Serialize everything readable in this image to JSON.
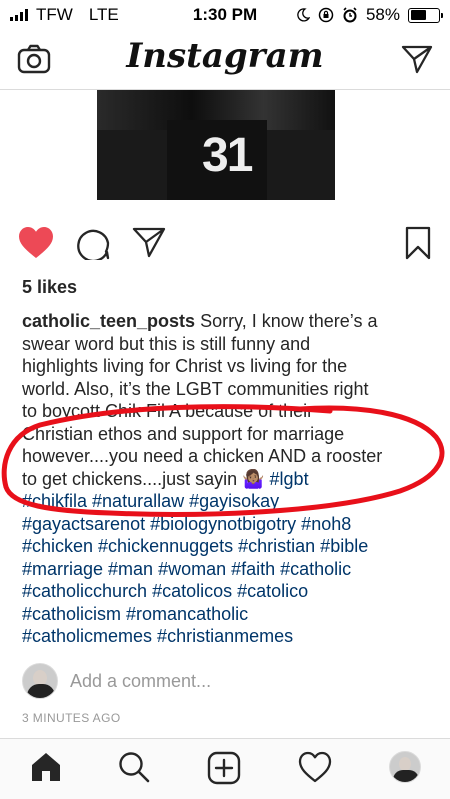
{
  "status_bar": {
    "carrier": "TFW",
    "network": "LTE",
    "time": "1:30 PM",
    "battery": "58%",
    "battery_level": 0.58
  },
  "header": {
    "logo": "Instagram"
  },
  "post": {
    "photo_text": "31",
    "liked": true,
    "likes": "5 likes",
    "username": "catholic_teen_posts",
    "caption_lines": [
      " Sorry, I know there’s a",
      "swear word but this is still funny and",
      "highlights living for Christ vs living for the",
      "world. Also, it’s the LGBT communities right",
      "to boycott Chik Fil A because of their",
      "Christian ethos and support for marriage",
      "however....you need a chicken AND a rooster",
      "to get chickens....just sayin 🤷🏽‍♀️ "
    ],
    "hashtags_first": "#lgbt",
    "hashtag_lines": [
      "#chikfila #naturallaw #gayisokay",
      "#gayactsarenot #biologynotbigotry #noh8",
      "#chicken #chickennuggets #christian #bible",
      "#marriage #man #woman #faith #catholic",
      "#catholicchurch #catolicos #catolico",
      "#catholicism #romancatholic",
      "#catholicmemes #christianmemes"
    ],
    "comment_placeholder": "Add a comment...",
    "timestamp": "3 MINUTES AGO"
  },
  "colors": {
    "like_red": "#ed4956",
    "hashtag_blue": "#003569",
    "annotation_red": "#e8101a"
  },
  "icons": [
    "camera-icon",
    "direct-message-icon",
    "heart-icon",
    "comment-icon",
    "share-icon",
    "bookmark-icon",
    "home-icon",
    "search-icon",
    "add-post-icon",
    "activity-heart-icon",
    "profile-avatar"
  ]
}
